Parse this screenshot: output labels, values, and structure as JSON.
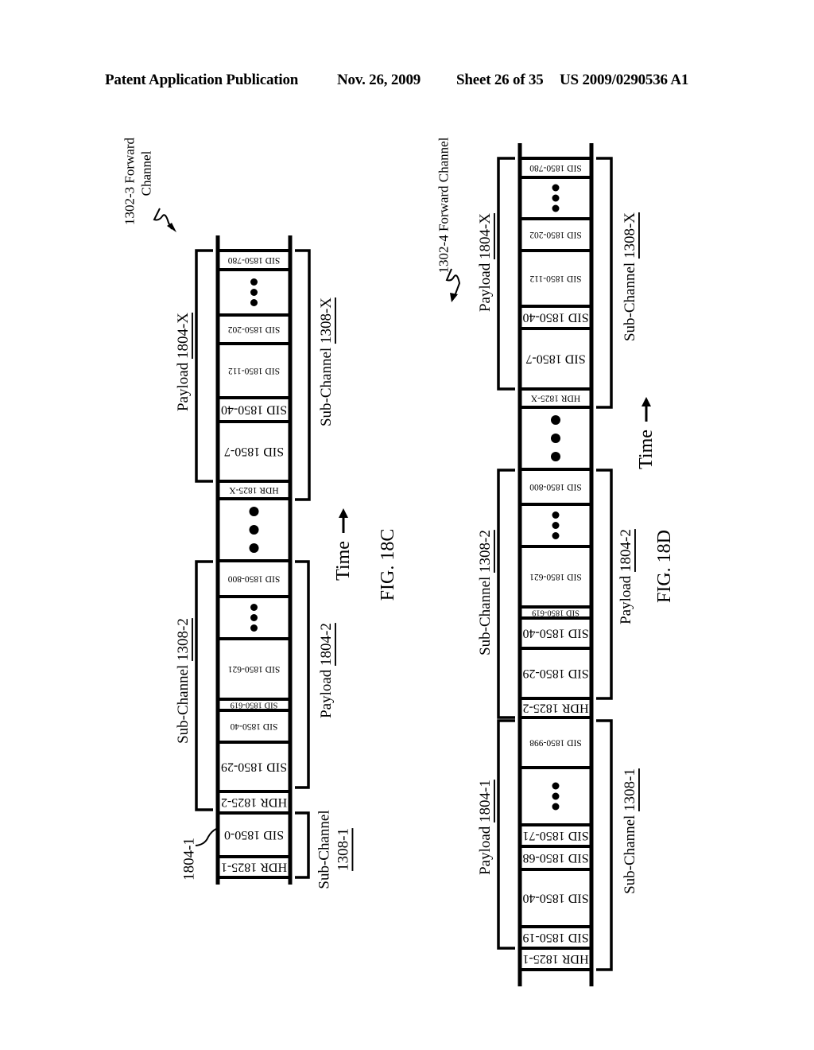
{
  "header": {
    "publication": "Patent Application Publication",
    "date": "Nov. 26, 2009",
    "sheet": "Sheet 26 of 35",
    "patent_number": "US 2009/0290536 A1"
  },
  "figures": [
    {
      "id": "18C",
      "caption": "FIG. 18C",
      "channel_label_line1": "1302-3 Forward",
      "channel_label_line2": "Channel",
      "time_label": "Time",
      "pointer_label": "1804-1",
      "cells": [
        {
          "label": "SID 1850-780",
          "kind": "small"
        },
        {
          "label": "",
          "kind": "dots"
        },
        {
          "label": "SID 1850-202",
          "kind": "small"
        },
        {
          "label": "SID 1850-112",
          "kind": "small"
        },
        {
          "label": "SID 1850-40",
          "kind": "large"
        },
        {
          "label": "SID 1850-7",
          "kind": "large"
        },
        {
          "label": "HDR 1825-X",
          "kind": "small"
        },
        {
          "label": "",
          "kind": "bigdots"
        },
        {
          "label": "SID 1850-800",
          "kind": "small"
        },
        {
          "label": "",
          "kind": "dots"
        },
        {
          "label": "SID 1850-621",
          "kind": "small"
        },
        {
          "label": "SID 1850-619",
          "kind": "small"
        },
        {
          "label": "SID 1850-40",
          "kind": "small"
        },
        {
          "label": "SID 1850-29",
          "kind": "large"
        },
        {
          "label": "HDR 1825-2",
          "kind": "large"
        },
        {
          "label": "SID 1850-0",
          "kind": "large"
        },
        {
          "label": "HDR 1825-1",
          "kind": "large"
        }
      ],
      "brackets": [
        {
          "label_prefix": "Payload ",
          "label_ref": "1804-X",
          "side": "left"
        },
        {
          "label_prefix": "Sub-Channel ",
          "label_ref": "1308-X",
          "side": "right"
        },
        {
          "label_prefix": "Sub-Channel ",
          "label_ref": "1308-2",
          "side": "left"
        },
        {
          "label_prefix": "Payload ",
          "label_ref": "1804-2",
          "side": "right"
        },
        {
          "label_prefix": "Sub-Channel",
          "label_ref": "1308-1",
          "side": "right"
        }
      ]
    },
    {
      "id": "18D",
      "caption": "FIG. 18D",
      "channel_label": "1302-4 Forward Channel",
      "time_label": "Time",
      "cells": [
        {
          "label": "SID 1850-780",
          "kind": "small"
        },
        {
          "label": "",
          "kind": "dots"
        },
        {
          "label": "SID 1850-202",
          "kind": "small"
        },
        {
          "label": "SID 1850-112",
          "kind": "small"
        },
        {
          "label": "SID 1850-40",
          "kind": "large"
        },
        {
          "label": "SID 1850-7",
          "kind": "large"
        },
        {
          "label": "HDR 1825-X",
          "kind": "small"
        },
        {
          "label": "",
          "kind": "bigdots"
        },
        {
          "label": "SID 1850-800",
          "kind": "small"
        },
        {
          "label": "",
          "kind": "dots"
        },
        {
          "label": "SID 1850-621",
          "kind": "small"
        },
        {
          "label": "SID 1850-619",
          "kind": "small"
        },
        {
          "label": "SID 1850-40",
          "kind": "large"
        },
        {
          "label": "SID 1850-29",
          "kind": "large"
        },
        {
          "label": "HDR 1825-2",
          "kind": "large"
        },
        {
          "label": "SID 1850-998",
          "kind": "small"
        },
        {
          "label": "",
          "kind": "dots"
        },
        {
          "label": "SID 1850-71",
          "kind": "large"
        },
        {
          "label": "SID 1850-68",
          "kind": "large"
        },
        {
          "label": "SID 1850-40",
          "kind": "large"
        },
        {
          "label": "SID 1850-19",
          "kind": "large"
        },
        {
          "label": "HDR 1825-1",
          "kind": "large"
        }
      ],
      "brackets": [
        {
          "label_prefix": "Payload ",
          "label_ref": "1804-X",
          "side": "left"
        },
        {
          "label_prefix": "Sub-Channel ",
          "label_ref": "1308-X",
          "side": "right"
        },
        {
          "label_prefix": "Sub-Channel ",
          "label_ref": "1308-2",
          "side": "left"
        },
        {
          "label_prefix": "Payload ",
          "label_ref": "1804-2",
          "side": "right"
        },
        {
          "label_prefix": "Payload ",
          "label_ref": "1804-1",
          "side": "left"
        },
        {
          "label_prefix": "Sub-Channel ",
          "label_ref": "1308-1",
          "side": "right"
        }
      ]
    }
  ]
}
